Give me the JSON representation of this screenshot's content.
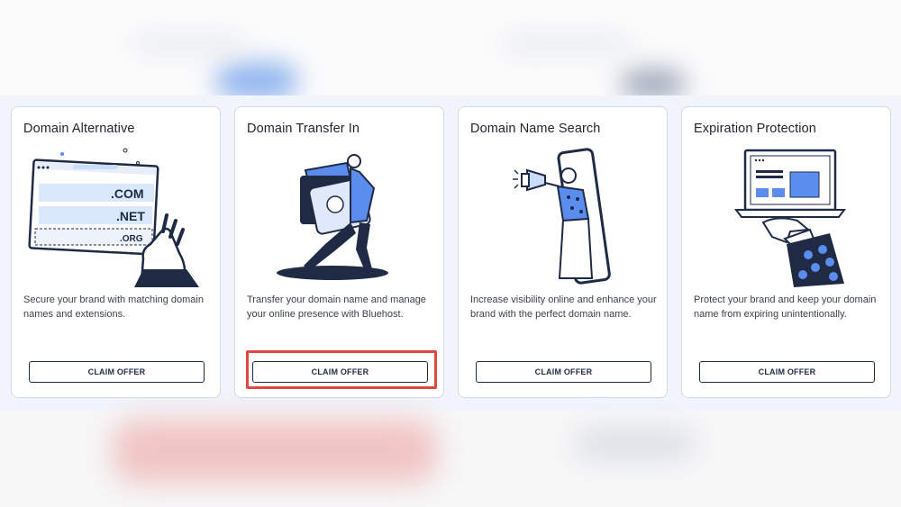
{
  "cards": [
    {
      "title": "Domain Alternative",
      "description": "Secure your brand with matching domain names and extensions.",
      "button_label": "CLAIM OFFER",
      "illustration_text": [
        ".COM",
        ".NET",
        ".ORG"
      ]
    },
    {
      "title": "Domain Transfer In",
      "description": "Transfer your domain name and manage your online presence with Bluehost.",
      "button_label": "CLAIM OFFER"
    },
    {
      "title": "Domain Name Search",
      "description": "Increase visibility online and enhance your brand with the perfect domain name.",
      "button_label": "CLAIM OFFER"
    },
    {
      "title": "Expiration Protection",
      "description": "Protect your brand and keep your domain name from expiring unintentionally.",
      "button_label": "CLAIM OFFER"
    }
  ],
  "highlighted_card": 1,
  "colors": {
    "accent_blue": "#5b8def",
    "light_blue": "#c9dcf8",
    "dark_navy": "#1f2a44",
    "highlight_red": "#e2473f",
    "card_border": "#cfd9e8"
  }
}
